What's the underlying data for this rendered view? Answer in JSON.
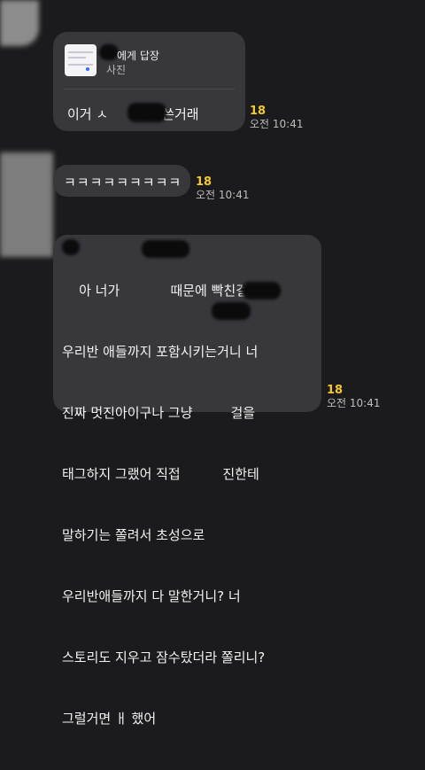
{
  "messages": [
    {
      "reply": {
        "header": "에게 답장",
        "subtitle": "사진"
      },
      "text": "이거 ㅅ      한테 쓴거래",
      "unread": "18",
      "time": "오전 10:41"
    },
    {
      "text": "ㅋㅋㅋㅋㅋㅋㅋㅋㅋ",
      "unread": "18",
      "time": "오전 10:41"
    },
    {
      "lines": [
        "    아 너가            때문에 빡친걸 ㅐ",
        "우리반 애들까지 포함시키는거니 너",
        "진짜 멋진아이구나 그냥         걸을",
        "태그하지 그랬어 직접          진한테",
        "말하기는 쫄려서 초성으로",
        "우리반애들까지 다 말한거니? 너",
        "스토리도 지우고 잠수탔더라 쫄리니?",
        "그럴거면 ㅐ 했어"
      ],
      "unread": "18",
      "time": "오전 10:41"
    }
  ],
  "colors": {
    "background": "#1b1b1d",
    "bubble": "#38383c",
    "unread_count": "#f2c733",
    "timestamp": "#bdbdbd"
  }
}
